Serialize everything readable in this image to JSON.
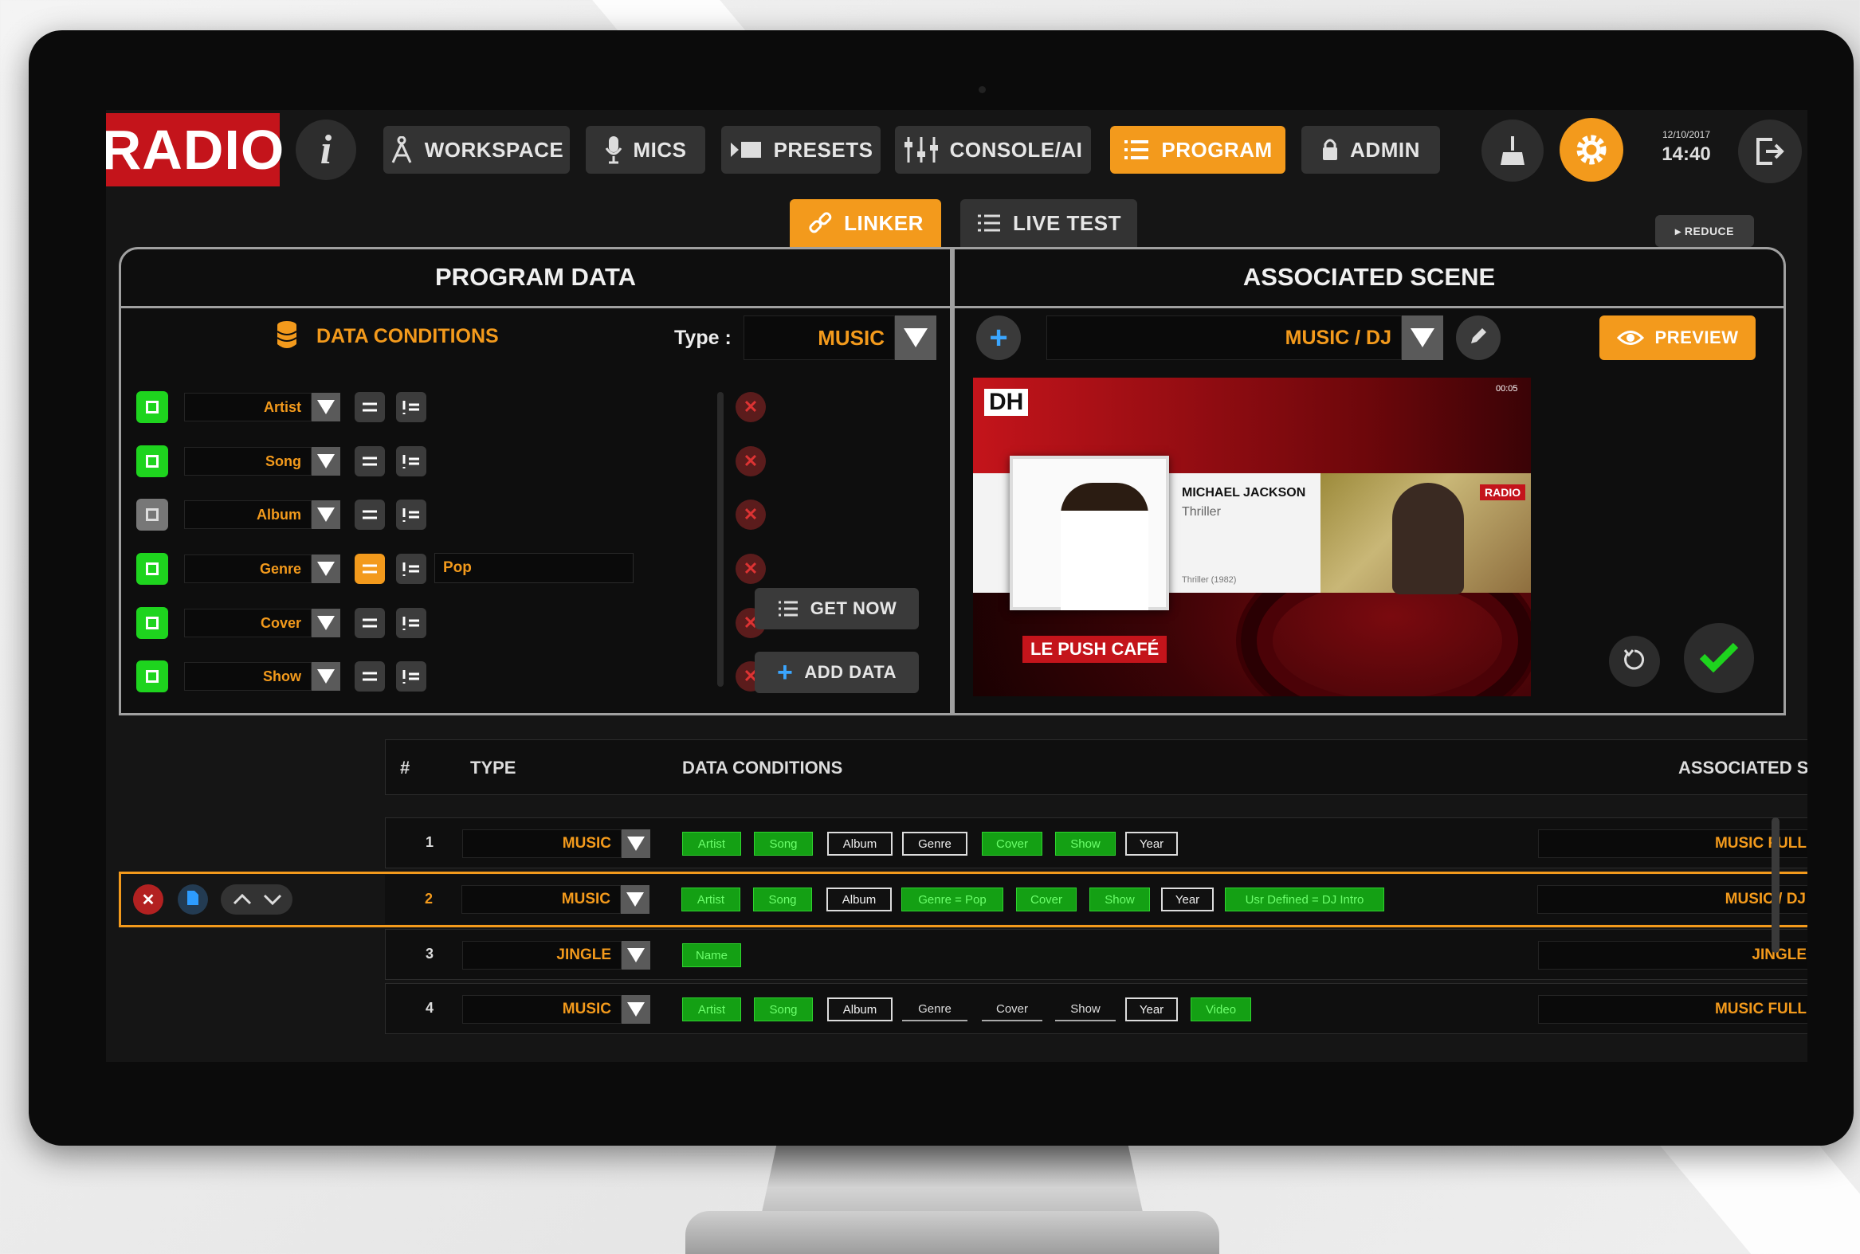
{
  "nav": {
    "logo": "RADIO",
    "info_label": "i",
    "items": [
      {
        "label": "WORKSPACE"
      },
      {
        "label": "MICS"
      },
      {
        "label": "PRESETS"
      },
      {
        "label": "CONSOLE/AI"
      },
      {
        "label": "PROGRAM"
      },
      {
        "label": "ADMIN"
      }
    ],
    "date": "12/10/2017",
    "time": "14:40"
  },
  "subtabs": {
    "linker": "LINKER",
    "live_test": "LIVE TEST",
    "reduce": "▸ REDUCE"
  },
  "program_data": {
    "title": "PROGRAM DATA",
    "conditions_label": "DATA CONDITIONS",
    "type_label": "Type :",
    "type_value": "MUSIC",
    "rows": [
      {
        "field": "Artist",
        "enabled": true,
        "value": ""
      },
      {
        "field": "Song",
        "enabled": true,
        "value": ""
      },
      {
        "field": "Album",
        "enabled": false,
        "value": ""
      },
      {
        "field": "Genre",
        "enabled": true,
        "value": "Pop"
      },
      {
        "field": "Cover",
        "enabled": true,
        "value": ""
      },
      {
        "field": "Show",
        "enabled": true,
        "value": ""
      }
    ],
    "get_now": "GET NOW",
    "add_data": "ADD DATA"
  },
  "scene": {
    "title": "ASSOCIATED SCENE",
    "selected": "MUSIC / DJ",
    "preview": "PREVIEW",
    "preview_logo": "DH",
    "artist": "MICHAEL JACKSON",
    "album": "Thriller",
    "year": "Thriller (1982)",
    "show": "LE PUSH CAFÉ",
    "live_badge": "RADIO",
    "clock": "00:05",
    "colors": {
      "accent": "#f39a1c",
      "confirm": "#1ed41e",
      "scene_red": "#c4141b"
    }
  },
  "table": {
    "headers": {
      "num": "#",
      "type": "TYPE",
      "conditions": "DATA CONDITIONS",
      "scene": "ASSOCIATED SCENE"
    },
    "rows": [
      {
        "num": "1",
        "type": "MUSIC",
        "scene": "MUSIC FULL",
        "tags": [
          {
            "text": "Artist",
            "style": "g"
          },
          {
            "text": "Song",
            "style": "g"
          },
          {
            "text": "Album",
            "style": "w"
          },
          {
            "text": "Genre",
            "style": "w"
          },
          {
            "text": "Cover",
            "style": "g"
          },
          {
            "text": "Show",
            "style": "g"
          },
          {
            "text": "Year",
            "style": "w"
          }
        ]
      },
      {
        "num": "2",
        "type": "MUSIC",
        "scene": "MUSIC / DJ",
        "selected": true,
        "tags": [
          {
            "text": "Artist",
            "style": "g"
          },
          {
            "text": "Song",
            "style": "g"
          },
          {
            "text": "Album",
            "style": "w"
          },
          {
            "text": "Genre = Pop",
            "style": "g"
          },
          {
            "text": "Cover",
            "style": "g"
          },
          {
            "text": "Show",
            "style": "g"
          },
          {
            "text": "Year",
            "style": "w"
          },
          {
            "text": "Usr Defined = DJ Intro",
            "style": "g"
          }
        ]
      },
      {
        "num": "3",
        "type": "JINGLE",
        "scene": "JINGLE",
        "tags": [
          {
            "text": "Name",
            "style": "g"
          }
        ]
      },
      {
        "num": "4",
        "type": "MUSIC",
        "scene": "MUSIC FULL",
        "tags": [
          {
            "text": "Artist",
            "style": "g"
          },
          {
            "text": "Song",
            "style": "g"
          },
          {
            "text": "Album",
            "style": "w"
          },
          {
            "text": "Genre",
            "style": "p"
          },
          {
            "text": "Cover",
            "style": "p"
          },
          {
            "text": "Show",
            "style": "p"
          },
          {
            "text": "Year",
            "style": "w"
          },
          {
            "text": "Video",
            "style": "g"
          }
        ]
      }
    ]
  }
}
